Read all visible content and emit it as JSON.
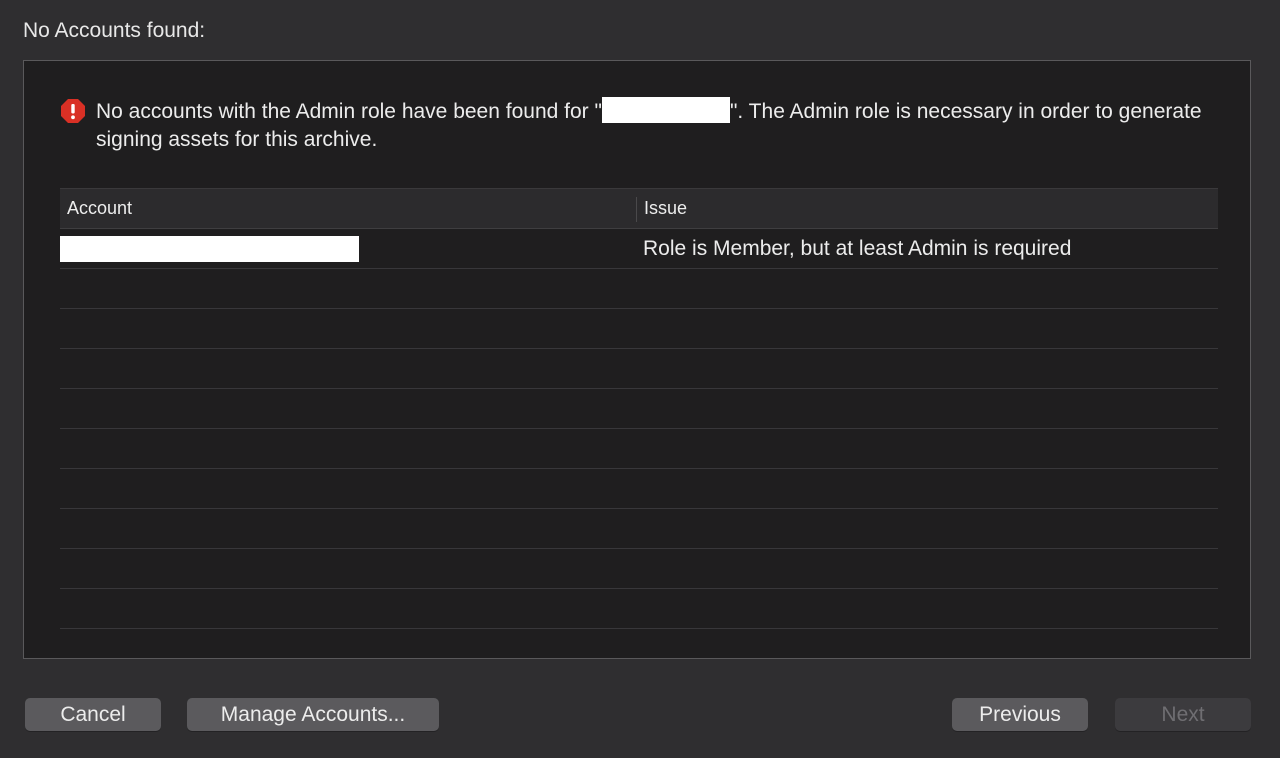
{
  "dialog": {
    "title": "No Accounts found:",
    "message_part1": "No accounts with the Admin role have been found for \"",
    "message_part2": "\". The Admin role is necessary in order to generate signing assets for this archive.",
    "error_icon": "exclamation-octagon-icon",
    "error_color": "#d93025"
  },
  "table": {
    "columns": [
      "Account",
      "Issue"
    ],
    "rows": [
      {
        "account": "[redacted]",
        "issue": "Role is Member, but at least Admin is required"
      }
    ]
  },
  "buttons": {
    "cancel": "Cancel",
    "manage_accounts": "Manage Accounts...",
    "previous": "Previous",
    "next": "Next"
  }
}
